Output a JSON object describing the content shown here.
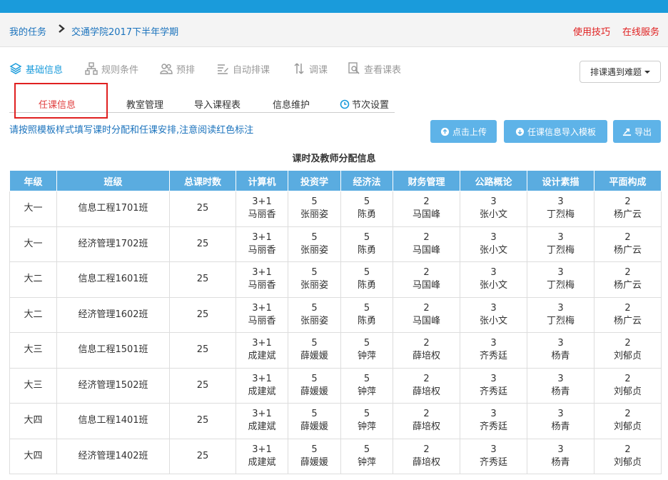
{
  "breadcrumb": {
    "root": "我的任务",
    "current": "交通学院2017下半年学期"
  },
  "header_links": {
    "help": "使用技巧",
    "service": "在线服务"
  },
  "toolbar": [
    {
      "label": "基础信息",
      "icon": "layers-icon",
      "active": true
    },
    {
      "label": "规则条件",
      "icon": "sitemap-icon",
      "active": false
    },
    {
      "label": "预排",
      "icon": "users-icon",
      "active": false
    },
    {
      "label": "自动排课",
      "icon": "edit-list-icon",
      "active": false
    },
    {
      "label": "调课",
      "icon": "swap-icon",
      "active": false
    },
    {
      "label": "查看课表",
      "icon": "search-doc-icon",
      "active": false
    }
  ],
  "trouble_button": "排课遇到难题",
  "subtabs": [
    "任课信息",
    "教室管理",
    "导入课程表",
    "信息维护",
    "节次设置"
  ],
  "hint": "请按照模板样式填写课时分配和任课安排,注意阅读红色标注",
  "buttons": {
    "upload": "点击上传",
    "template": "任课信息导入模板",
    "export": "导出"
  },
  "table_title": "课时及教师分配信息",
  "columns": [
    "年级",
    "班级",
    "总课时数",
    "计算机",
    "投资学",
    "经济法",
    "财务管理",
    "公路概论",
    "设计素描",
    "平面构成"
  ],
  "rows": [
    {
      "grade": "大一",
      "class": "信息工程1701班",
      "total": "25",
      "courses": [
        [
          "3+1",
          "马丽香"
        ],
        [
          "5",
          "张丽姿"
        ],
        [
          "5",
          "陈勇"
        ],
        [
          "2",
          "马国峰"
        ],
        [
          "3",
          "张小文"
        ],
        [
          "3",
          "丁烈梅"
        ],
        [
          "2",
          "杨广云"
        ]
      ]
    },
    {
      "grade": "大一",
      "class": "经济管理1702班",
      "total": "25",
      "courses": [
        [
          "3+1",
          "马丽香"
        ],
        [
          "5",
          "张丽姿"
        ],
        [
          "5",
          "陈勇"
        ],
        [
          "2",
          "马国峰"
        ],
        [
          "3",
          "张小文"
        ],
        [
          "3",
          "丁烈梅"
        ],
        [
          "2",
          "杨广云"
        ]
      ]
    },
    {
      "grade": "大二",
      "class": "信息工程1601班",
      "total": "25",
      "courses": [
        [
          "3+1",
          "马丽香"
        ],
        [
          "5",
          "张丽姿"
        ],
        [
          "5",
          "陈勇"
        ],
        [
          "2",
          "马国峰"
        ],
        [
          "3",
          "张小文"
        ],
        [
          "3",
          "丁烈梅"
        ],
        [
          "2",
          "杨广云"
        ]
      ]
    },
    {
      "grade": "大二",
      "class": "经济管理1602班",
      "total": "25",
      "courses": [
        [
          "3+1",
          "马丽香"
        ],
        [
          "5",
          "张丽姿"
        ],
        [
          "5",
          "陈勇"
        ],
        [
          "2",
          "马国峰"
        ],
        [
          "3",
          "张小文"
        ],
        [
          "3",
          "丁烈梅"
        ],
        [
          "2",
          "杨广云"
        ]
      ]
    },
    {
      "grade": "大三",
      "class": "信息工程1501班",
      "total": "25",
      "courses": [
        [
          "3+1",
          "成建斌"
        ],
        [
          "5",
          "薛媛媛"
        ],
        [
          "5",
          "钟萍"
        ],
        [
          "2",
          "薛培权"
        ],
        [
          "3",
          "齐秀廷"
        ],
        [
          "3",
          "杨青"
        ],
        [
          "2",
          "刘郁贞"
        ]
      ]
    },
    {
      "grade": "大三",
      "class": "经济管理1502班",
      "total": "25",
      "courses": [
        [
          "3+1",
          "成建斌"
        ],
        [
          "5",
          "薛媛媛"
        ],
        [
          "5",
          "钟萍"
        ],
        [
          "2",
          "薛培权"
        ],
        [
          "3",
          "齐秀廷"
        ],
        [
          "3",
          "杨青"
        ],
        [
          "2",
          "刘郁贞"
        ]
      ]
    },
    {
      "grade": "大四",
      "class": "信息工程1401班",
      "total": "25",
      "courses": [
        [
          "3+1",
          "成建斌"
        ],
        [
          "5",
          "薛媛媛"
        ],
        [
          "5",
          "钟萍"
        ],
        [
          "2",
          "薛培权"
        ],
        [
          "3",
          "齐秀廷"
        ],
        [
          "3",
          "杨青"
        ],
        [
          "2",
          "刘郁贞"
        ]
      ]
    },
    {
      "grade": "大四",
      "class": "经济管理1402班",
      "total": "25",
      "courses": [
        [
          "3+1",
          "成建斌"
        ],
        [
          "5",
          "薛媛媛"
        ],
        [
          "5",
          "钟萍"
        ],
        [
          "2",
          "薛培权"
        ],
        [
          "3",
          "齐秀廷"
        ],
        [
          "3",
          "杨青"
        ],
        [
          "2",
          "刘郁贞"
        ]
      ]
    }
  ],
  "colors": {
    "accent": "#1a9bdb",
    "header_bg": "#5aace0",
    "alert": "#e02020",
    "button": "#5eb3e8"
  }
}
